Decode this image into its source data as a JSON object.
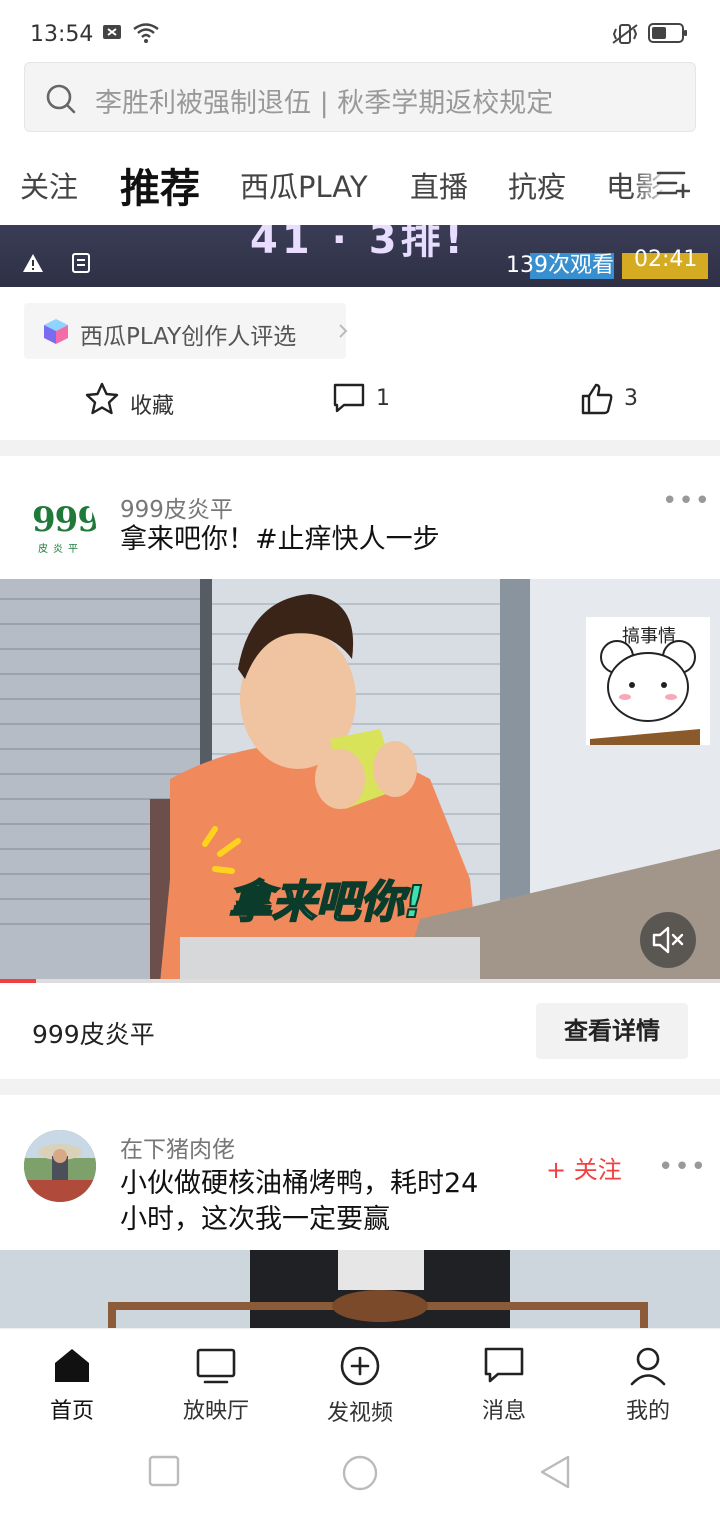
{
  "status_bar": {
    "time": "13:54"
  },
  "search": {
    "placeholder": "李胜利被强制退伍 | 秋季学期返校规定"
  },
  "tabs": [
    {
      "label": "关注",
      "active": false
    },
    {
      "label": "推荐",
      "active": true
    },
    {
      "label": "西瓜PLAY",
      "active": false
    },
    {
      "label": "直播",
      "active": false
    },
    {
      "label": "抗疫",
      "active": false
    },
    {
      "label": "电影",
      "active": false
    }
  ],
  "prev_video": {
    "banner_text": "41 · 3排!",
    "views": "139次观看",
    "duration": "02:41"
  },
  "creator_pill": {
    "label": "西瓜PLAY创作人评选"
  },
  "actions": {
    "favorite_label": "收藏",
    "comment_count": "1",
    "like_count": "3"
  },
  "ad_post": {
    "author": "999皮炎平",
    "logo_text": "999",
    "logo_sub": "皮炎平",
    "title": "拿来吧你！#止痒快人一步",
    "video_caption": "拿来吧你!",
    "sticker_text": "搞事情",
    "progress": 0.05,
    "sponsor_name": "999皮炎平",
    "details_label": "查看详情"
  },
  "post2": {
    "author": "在下猪肉佬",
    "title_line1": "小伙做硬核油桶烤鸭，耗时24",
    "title_line2": "小时，这次我一定要赢",
    "follow_label": "+ 关注"
  },
  "bottom_nav": [
    {
      "label": "首页",
      "icon": "home-icon",
      "active": true
    },
    {
      "label": "放映厅",
      "icon": "tv-icon",
      "active": false
    },
    {
      "label": "发视频",
      "icon": "add-video-icon",
      "active": false
    },
    {
      "label": "消息",
      "icon": "message-icon",
      "active": false
    },
    {
      "label": "我的",
      "icon": "profile-icon",
      "active": false
    }
  ],
  "colors": {
    "accent_red": "#f04142",
    "brand_green": "#1f7a3a"
  }
}
